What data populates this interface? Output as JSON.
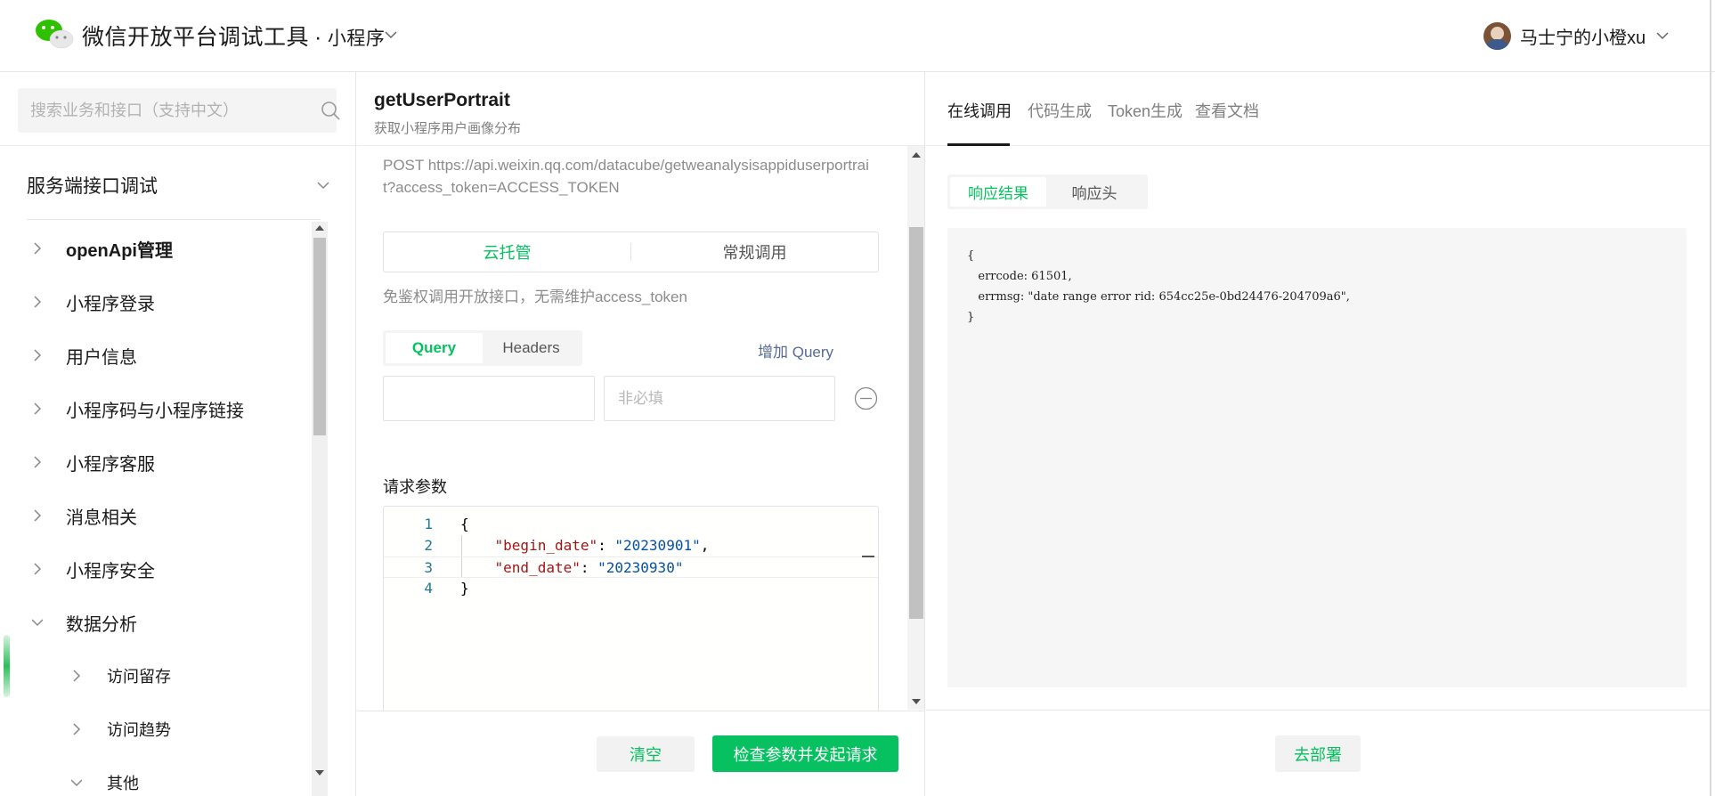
{
  "header": {
    "app_name": "微信开放平台调试工具",
    "separator": "·",
    "product": "小程序",
    "user_name": "马士宁的小橙xu"
  },
  "sidebar": {
    "search_placeholder": "搜索业务和接口（支持中文）",
    "section_title": "服务端接口调试",
    "items": [
      {
        "label": "openApi管理",
        "expanded": false
      },
      {
        "label": "小程序登录",
        "expanded": false
      },
      {
        "label": "用户信息",
        "expanded": false
      },
      {
        "label": "小程序码与小程序链接",
        "expanded": false
      },
      {
        "label": "小程序客服",
        "expanded": false
      },
      {
        "label": "消息相关",
        "expanded": false
      },
      {
        "label": "小程序安全",
        "expanded": false
      },
      {
        "label": "数据分析",
        "expanded": true
      }
    ],
    "sub_items": [
      {
        "label": "访问留存",
        "expanded": false
      },
      {
        "label": "访问趋势",
        "expanded": false
      },
      {
        "label": "其他",
        "expanded": true
      }
    ]
  },
  "api": {
    "name": "getUserPortrait",
    "description": "获取小程序用户画像分布",
    "url": "POST https://api.weixin.qq.com/datacube/getweanalysisappiduserportrait?access_token=ACCESS_TOKEN",
    "modes": [
      "云托管",
      "常规调用"
    ],
    "mode_hint": "免鉴权调用开放接口，无需维护access_token",
    "param_tabs": [
      "Query",
      "Headers"
    ],
    "add_query_label": "增加 Query",
    "param_key_value": "",
    "param_value_placeholder": "非必填",
    "request_params_label": "请求参数",
    "code_lines": [
      {
        "num": "1",
        "indent": "",
        "key": "",
        "sep": "",
        "value": "",
        "tail": "{"
      },
      {
        "num": "2",
        "indent": "    ",
        "key": "\"begin_date\"",
        "sep": ": ",
        "value": "\"20230901\"",
        "tail": ","
      },
      {
        "num": "3",
        "indent": "    ",
        "key": "\"end_date\"",
        "sep": ": ",
        "value": "\"20230930\"",
        "tail": ""
      },
      {
        "num": "4",
        "indent": "",
        "key": "",
        "sep": "",
        "value": "",
        "tail": "}"
      }
    ],
    "clear_label": "清空",
    "send_label": "检查参数并发起请求"
  },
  "right": {
    "tabs": [
      "在线调用",
      "代码生成",
      "Token生成",
      "查看文档"
    ],
    "active_tab": "在线调用",
    "response_tabs": [
      "响应结果",
      "响应头"
    ],
    "response_lines": [
      "{",
      "   errcode: 61501,",
      "   errmsg: \"date range error rid: 654cc25e-0bd24476-204709a6\",",
      "}"
    ],
    "deploy_label": "去部署"
  },
  "colors": {
    "accent": "#07c160",
    "link": "#576b95"
  }
}
